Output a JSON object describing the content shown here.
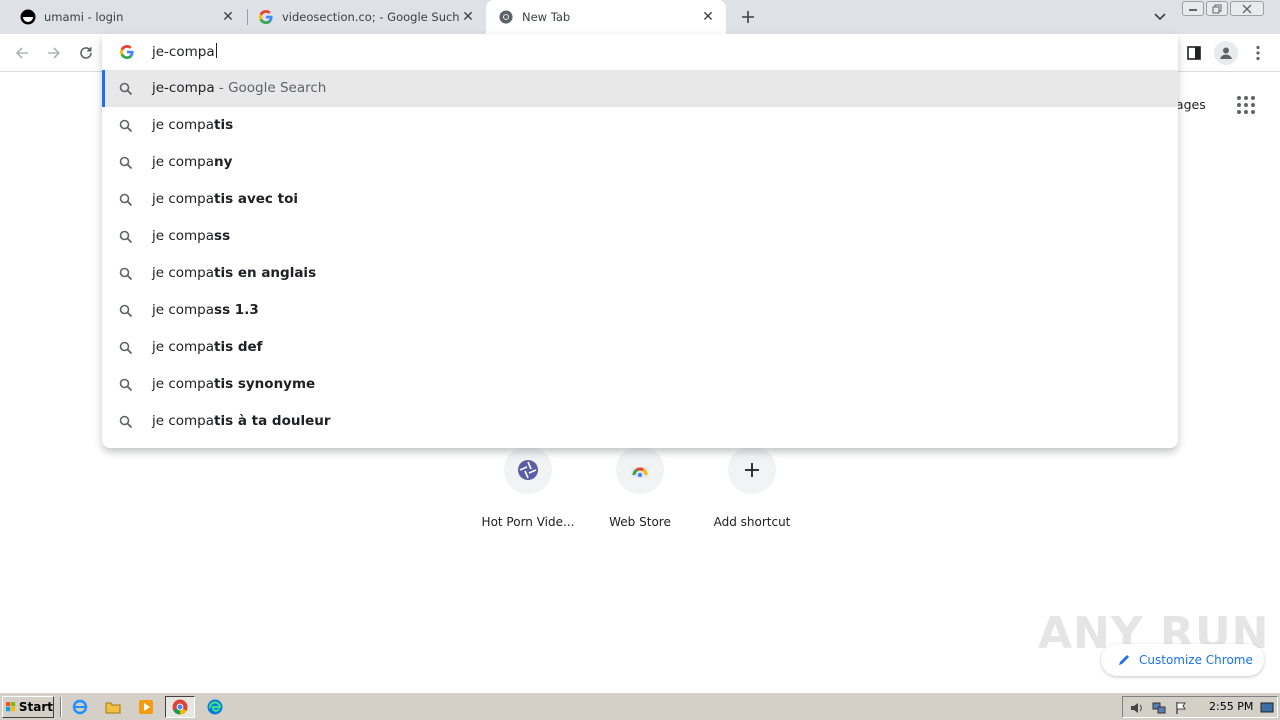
{
  "tabs": [
    {
      "title": "umami - login",
      "icon": "umami-favicon",
      "active": false
    },
    {
      "title": "videosection.co; - Google Suche",
      "icon": "google-favicon",
      "active": false
    },
    {
      "title": "New Tab",
      "icon": "chrome-favicon",
      "active": true
    }
  ],
  "omnibox": {
    "input_value": "je-compa",
    "suggestions": [
      {
        "typed": "je-compa",
        "completion": "",
        "description": " - Google Search"
      },
      {
        "typed": "je compa",
        "completion": "tis",
        "description": ""
      },
      {
        "typed": "je compa",
        "completion": "ny",
        "description": ""
      },
      {
        "typed": "je compa",
        "completion": "tis avec toi",
        "description": ""
      },
      {
        "typed": "je compa",
        "completion": "ss",
        "description": ""
      },
      {
        "typed": "je compa",
        "completion": "tis en anglais",
        "description": ""
      },
      {
        "typed": "je compa",
        "completion": "ss 1.3",
        "description": ""
      },
      {
        "typed": "je compa",
        "completion": "tis def",
        "description": ""
      },
      {
        "typed": "je compa",
        "completion": "tis synonyme",
        "description": ""
      },
      {
        "typed": "je compa",
        "completion": "tis à ta douleur",
        "description": ""
      }
    ]
  },
  "page": {
    "images_link": "nages",
    "shortcuts": [
      {
        "label": "Hot Porn Vide...",
        "icon": "aperture-icon"
      },
      {
        "label": "Web Store",
        "icon": "web-store-icon"
      },
      {
        "label": "Add shortcut",
        "icon": "plus-icon"
      }
    ],
    "customize_label": "Customize Chrome",
    "watermark": "ANY RUN"
  },
  "taskbar": {
    "start_label": "Start",
    "clock": "2:55 PM"
  },
  "colors": {
    "accent": "#1a73e8",
    "tabstrip": "#dee1e6",
    "selected_row": "#e8e8e9",
    "taskbar": "#d4d0c8"
  }
}
